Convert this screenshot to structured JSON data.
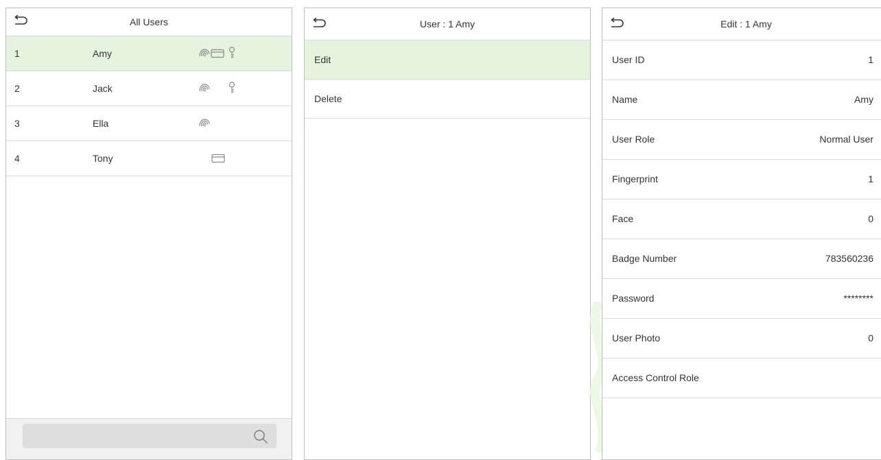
{
  "users_panel": {
    "title": "All Users",
    "rows": [
      {
        "id": "1",
        "name": "Amy",
        "icons": [
          "fingerprint-icon",
          "card-icon",
          "key-icon"
        ]
      },
      {
        "id": "2",
        "name": "Jack",
        "icons": [
          "fingerprint-icon",
          "key-icon"
        ]
      },
      {
        "id": "3",
        "name": "Ella",
        "icons": [
          "fingerprint-icon"
        ]
      },
      {
        "id": "4",
        "name": "Tony",
        "icons": [
          "card-icon"
        ]
      }
    ],
    "search_icon": "search-icon"
  },
  "user_menu_panel": {
    "title": "User : 1 Amy",
    "items": [
      {
        "label": "Edit"
      },
      {
        "label": "Delete"
      }
    ]
  },
  "edit_panel": {
    "title": "Edit : 1 Amy",
    "fields": [
      {
        "label": "User ID",
        "value": "1"
      },
      {
        "label": "Name",
        "value": "Amy"
      },
      {
        "label": "User Role",
        "value": "Normal User"
      },
      {
        "label": "Fingerprint",
        "value": "1"
      },
      {
        "label": "Face",
        "value": "0"
      },
      {
        "label": "Badge Number",
        "value": "783560236"
      },
      {
        "label": "Password",
        "value": "********"
      },
      {
        "label": "User Photo",
        "value": "0"
      },
      {
        "label": "Access Control Role",
        "value": ""
      }
    ]
  },
  "colors": {
    "selected_row": "#e6f3df",
    "icon_gray": "#8a8a8a",
    "border": "#bdbdbd"
  }
}
